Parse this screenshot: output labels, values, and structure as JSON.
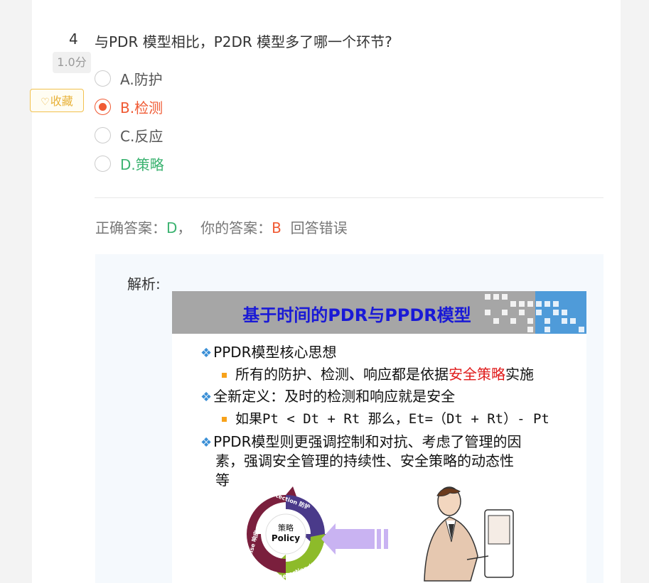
{
  "question": {
    "number": "4",
    "title": "与PDR 模型相比，P2DR 模型多了哪一个环节?",
    "score": "1.0分",
    "favorite_label": "收藏",
    "options": [
      {
        "label": "A.防护",
        "state": "none"
      },
      {
        "label": "B.检测",
        "state": "selected-wrong"
      },
      {
        "label": "C.反应",
        "state": "none"
      },
      {
        "label": "D.策略",
        "state": "correct"
      }
    ]
  },
  "result": {
    "correct_prefix": "正确答案：",
    "correct_value": "D",
    "separator": "，",
    "your_prefix": "你的答案：",
    "your_value": "B",
    "verdict": "回答错误"
  },
  "analysis": {
    "label": "解析:",
    "slide": {
      "title": "基于时间的PDR与PPDR模型",
      "b1": "PPDR模型核心思想",
      "b1_sub_pre": "所有的防护、检测、响应都是依据",
      "b1_sub_hl": "安全策略",
      "b1_sub_post": "实施",
      "b2": "全新定义：及时的检测和响应就是安全",
      "b2_sub": "如果Pt < Dt + Rt 那么，Et=（Dt + Rt）- Pt",
      "b3_l1": "PPDR模型则更强调控制和对抗、考虑了管理的因",
      "b3_l2": "素，强调安全管理的持续性、安全策略的动态性",
      "b3_l3": "等",
      "cycle": {
        "center_cn": "策略",
        "center_en": "Policy",
        "protection": "protection 防护",
        "detection": "detection 检测",
        "response": "response 响应"
      }
    }
  },
  "colors": {
    "accent_wrong": "#f05a33",
    "accent_right": "#3cb371",
    "favorite": "#e8b23a",
    "slide_title": "#1a1ad6"
  },
  "icons": [
    "heart-icon",
    "radio-icon",
    "diamond-bullet-icon",
    "square-bullet-icon"
  ]
}
